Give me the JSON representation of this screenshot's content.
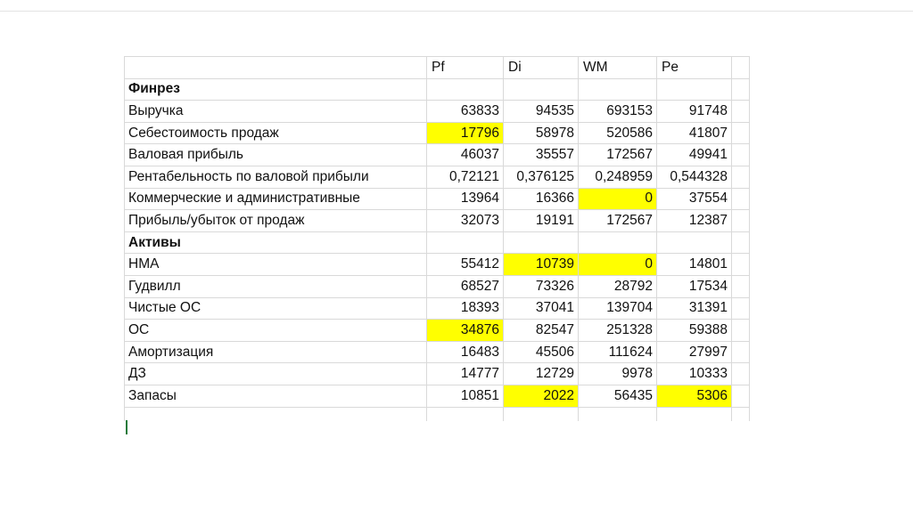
{
  "columns": [
    "",
    "Pf",
    "Di",
    "WM",
    "Pe"
  ],
  "rows": [
    {
      "label": "Финрез",
      "bold": true,
      "values": [
        "",
        "",
        "",
        ""
      ],
      "highlight": []
    },
    {
      "label": "Выручка",
      "values": [
        "63833",
        "94535",
        "693153",
        "91748"
      ],
      "highlight": []
    },
    {
      "label": "Себестоимость продаж",
      "values": [
        "17796",
        "58978",
        "520586",
        "41807"
      ],
      "highlight": [
        0
      ]
    },
    {
      "label": "Валовая прибыль",
      "values": [
        "46037",
        "35557",
        "172567",
        "49941"
      ],
      "highlight": []
    },
    {
      "label": "Рентабельность по валовой прибыли",
      "values": [
        "0,72121",
        "0,376125",
        "0,248959",
        "0,544328"
      ],
      "highlight": []
    },
    {
      "label": "Коммерческие и административные",
      "values": [
        "13964",
        "16366",
        "0",
        "37554"
      ],
      "highlight": [
        2
      ]
    },
    {
      "label": "Прибыль/убыток от продаж",
      "values": [
        "32073",
        "19191",
        "172567",
        "12387"
      ],
      "highlight": []
    },
    {
      "label": "Активы",
      "bold": true,
      "values": [
        "",
        "",
        "",
        ""
      ],
      "highlight": []
    },
    {
      "label": "НМА",
      "values": [
        "55412",
        "10739",
        "0",
        "14801"
      ],
      "highlight": [
        1,
        2
      ]
    },
    {
      "label": "Гудвилл",
      "values": [
        "68527",
        "73326",
        "28792",
        "17534"
      ],
      "highlight": []
    },
    {
      "label": "Чистые ОС",
      "values": [
        "18393",
        "37041",
        "139704",
        "31391"
      ],
      "highlight": []
    },
    {
      "label": "ОС",
      "values": [
        "34876",
        "82547",
        "251328",
        "59388"
      ],
      "highlight": [
        0
      ]
    },
    {
      "label": "Амортизация",
      "values": [
        "16483",
        "45506",
        "111624",
        "27997"
      ],
      "highlight": []
    },
    {
      "label": "ДЗ",
      "values": [
        "14777",
        "12729",
        "9978",
        "10333"
      ],
      "highlight": []
    },
    {
      "label": "Запасы",
      "values": [
        "10851",
        "2022",
        "56435",
        "5306"
      ],
      "highlight": [
        1,
        3
      ]
    }
  ],
  "highlight_color": "#ffff00"
}
